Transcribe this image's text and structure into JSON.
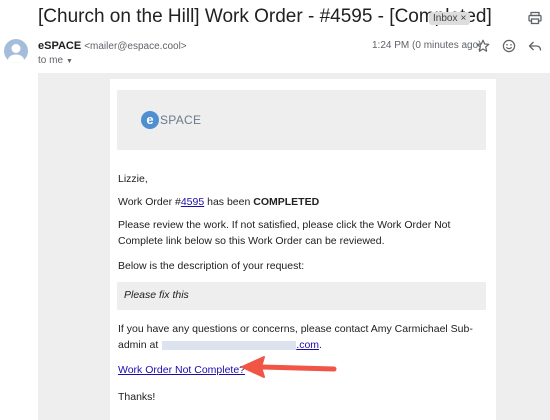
{
  "email": {
    "subject": "[Church on the Hill] Work Order - #4595 - [Completed]",
    "label": "Inbox",
    "label_close": "×",
    "sender_name": "eSPACE",
    "sender_email": "<mailer@espace.cool>",
    "to": "to me",
    "timestamp": "1:24 PM (0 minutes ago)"
  },
  "icons": {
    "print": "print-icon",
    "star": "star-icon",
    "emoji": "emoji-icon",
    "reply": "reply-icon",
    "avatar": "avatar-icon"
  },
  "body": {
    "logo_mark": "e",
    "logo_text": "SPACE",
    "greeting": "Lizzie,",
    "wo_prefix": "Work Order #",
    "wo_number": "4595",
    "wo_mid": " has been ",
    "wo_status": "COMPLETED",
    "review_line1": "Please review the work. If not satisfied, please click the Work Order Not",
    "review_line2": "Complete link below so this Work Order can be reviewed.",
    "below_text": "Below is the description of your request:",
    "description": "Please fix this",
    "questions_line1": "If you have any questions or concerns, please contact Amy Carmichael Sub-",
    "questions_line2_prefix": "admin at",
    "questions_line2_suffix": ".com",
    "questions_end": ".",
    "not_complete_link": "Work Order Not Complete?",
    "thanks": "Thanks!"
  },
  "colors": {
    "link": "#1a0dab",
    "arrow": "#f05545",
    "logo_blue": "#4d8fd1"
  }
}
